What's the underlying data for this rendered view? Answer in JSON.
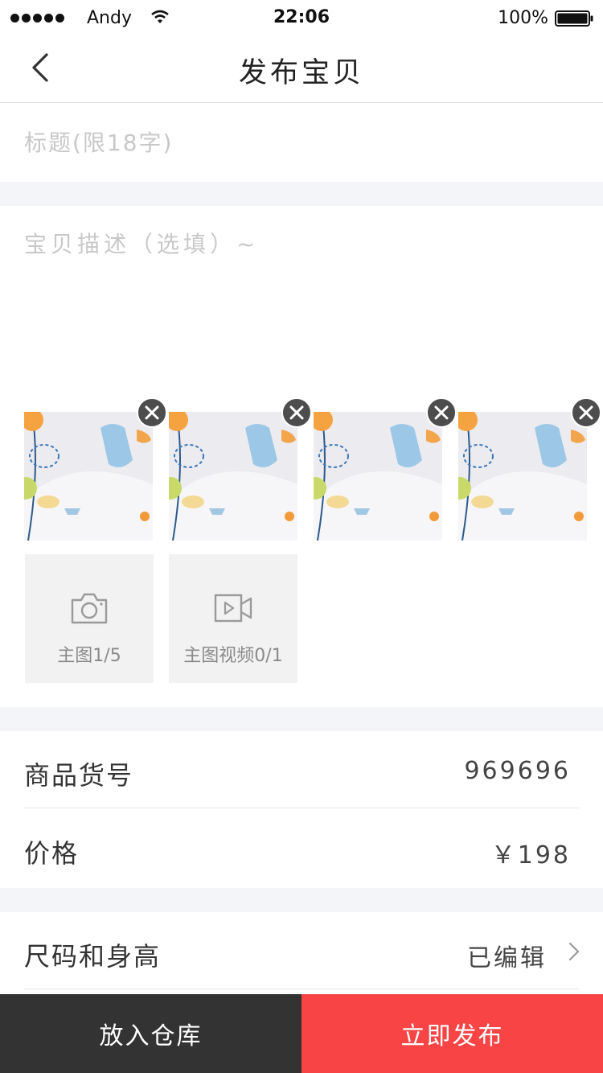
{
  "status_bar": {
    "carrier": "Andy",
    "time": "22:06",
    "battery": "100%"
  },
  "nav": {
    "title": "发布宝贝",
    "back_icon": "chevron-left-icon"
  },
  "form": {
    "title_placeholder": "标题(限18字)",
    "description_placeholder": "宝贝描述（选填）~"
  },
  "media": {
    "photos": [
      {
        "remove_icon": "close-icon"
      },
      {
        "remove_icon": "close-icon"
      },
      {
        "remove_icon": "close-icon"
      },
      {
        "remove_icon": "close-icon"
      }
    ],
    "add_photo_label": "主图1/5",
    "add_photo_icon": "camera-icon",
    "add_video_label": "主图视频0/1",
    "add_video_icon": "video-icon"
  },
  "fields": {
    "item_number_label": "商品货号",
    "item_number_value": "969696",
    "price_label": "价格",
    "price_value": "￥198",
    "size_label": "尺码和身高",
    "size_value": "已编辑"
  },
  "actions": {
    "warehouse_label": "放入仓库",
    "publish_label": "立即发布"
  },
  "colors": {
    "publish": "#f84444",
    "warehouse": "#333333",
    "section_gap": "#f3f5f8"
  }
}
